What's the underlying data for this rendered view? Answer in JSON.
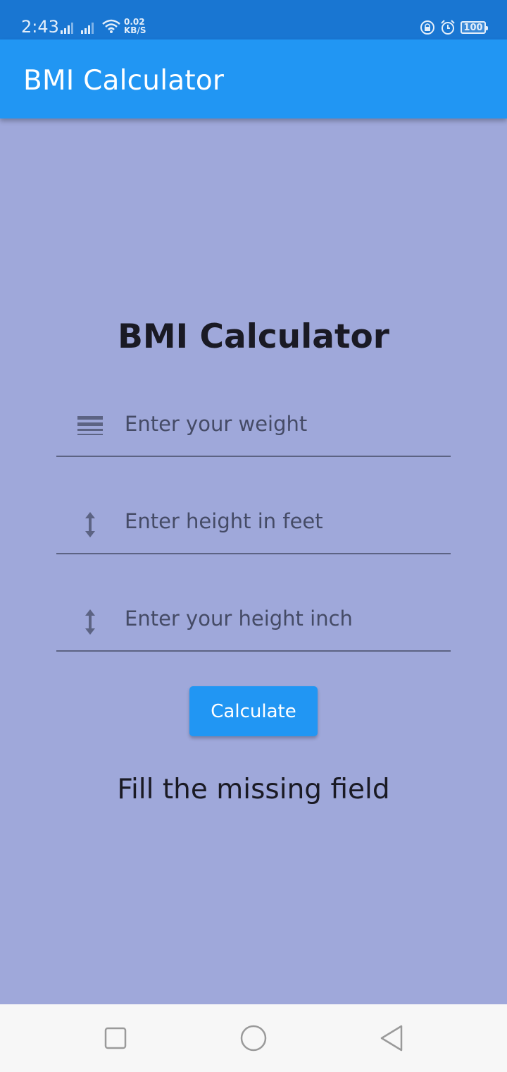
{
  "status_bar": {
    "time": "2:43",
    "net_speed_value": "0.02",
    "net_speed_unit": "KB/S",
    "battery": "100",
    "icons": [
      "signal-icon",
      "signal-icon",
      "wifi-icon",
      "lock-rotation-icon",
      "alarm-icon",
      "battery-icon"
    ]
  },
  "app_bar": {
    "title": "BMI Calculator"
  },
  "main": {
    "title": "BMI Calculator",
    "fields": [
      {
        "placeholder": "Enter your weight",
        "icon": "weight-lines-icon"
      },
      {
        "placeholder": "Enter height in feet",
        "icon": "height-arrow-icon"
      },
      {
        "placeholder": "Enter your height inch",
        "icon": "height-arrow-icon"
      }
    ],
    "calculate_label": "Calculate",
    "result_message": "Fill the missing field"
  },
  "nav_bar": {
    "icons": [
      "recent-apps-icon",
      "home-icon",
      "back-icon"
    ]
  },
  "colors": {
    "background": "#9FA8DA",
    "app_bar": "#2196F3",
    "status_bar": "#1976D2",
    "button": "#2196F3",
    "nav_bar": "#F7F7F7"
  }
}
